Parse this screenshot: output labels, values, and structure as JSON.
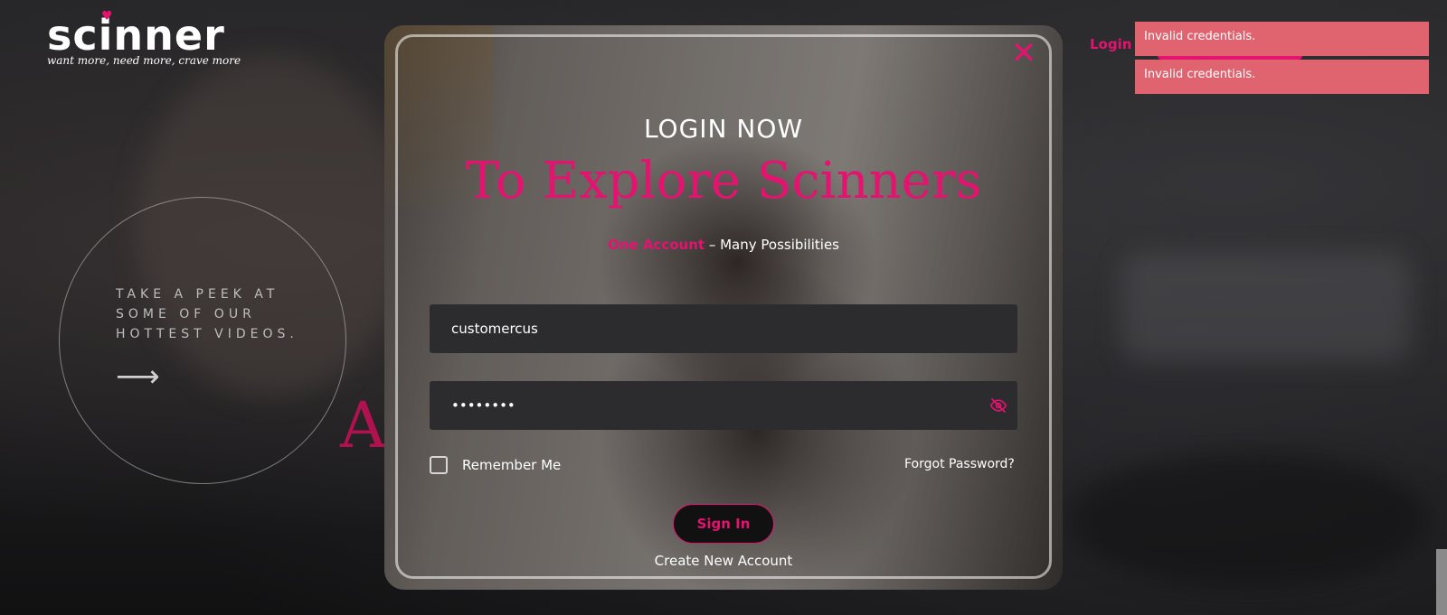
{
  "brand": {
    "logo_text": "scinner",
    "tagline": "want more, need more, crave more",
    "accent_color": "#e4136f"
  },
  "hero": {
    "peek_text": "TAKE A PEEK AT SOME OF OUR HOTTEST VIDEOS.",
    "arrow_icon": "arrow-right-icon",
    "partial_letter": "A"
  },
  "nav": {
    "login_label": "Login"
  },
  "toasts": [
    {
      "message": "Invalid credentials.",
      "color": "#e06470"
    },
    {
      "message": "Invalid credentials.",
      "color": "#e06470"
    }
  ],
  "modal": {
    "heading": "LOGIN NOW",
    "subheading": "To Explore Scinners",
    "tagline_accent": "One Account",
    "tagline_rest": " – Many Possibilities",
    "username_value": "customercus",
    "password_value": "••••••••",
    "remember_label": "Remember Me",
    "remember_checked": false,
    "forgot_label": "Forgot Password?",
    "signin_label": "Sign In",
    "create_label": "Create New Account",
    "close_icon": "close-icon",
    "eye_icon": "eye-off-icon"
  }
}
